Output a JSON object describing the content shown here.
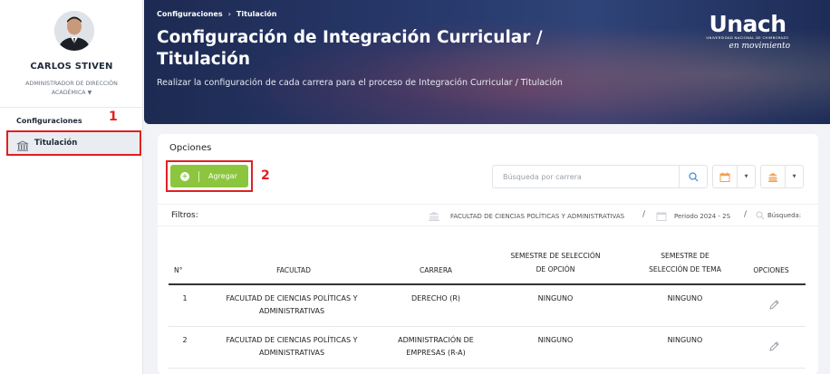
{
  "user": {
    "name": "CARLOS STIVEN",
    "role_line1": "ADMINISTRADOR DE DIRECCIÓN",
    "role_line2": "ACADÉMICA"
  },
  "sidebar": {
    "section": "Configuraciones",
    "items": [
      {
        "label": "Titulación",
        "icon": "institution-icon"
      }
    ]
  },
  "annotations": {
    "first": "1",
    "second": "2"
  },
  "breadcrumb": {
    "root": "Configuraciones",
    "current": "Titulación"
  },
  "header": {
    "title": "Configuración de Integración Curricular / Titulación",
    "subtitle": "Realizar la configuración de cada carrera para el proceso de Integración Curricular / Titulación"
  },
  "logo": {
    "brand": "Unach",
    "tagline": "UNIVERSIDAD NACIONAL DE CHIMBORAZO",
    "slogan": "en movimiento"
  },
  "options": {
    "title": "Opciones",
    "add_label": "Agregar",
    "search_placeholder": "Búsqueda por carrera"
  },
  "filters": {
    "label": "Filtros:",
    "faculty": "FACULTAD DE CIENCIAS POLÍTICAS Y ADMINISTRATIVAS",
    "period": "Periodo 2024 - 2S",
    "search": "Búsqueda:"
  },
  "table": {
    "headers": {
      "num": "N°",
      "faculty": "FACULTAD",
      "career": "CARRERA",
      "sem_option_1": "SEMESTRE DE SELECCIÓN",
      "sem_option_2": "DE OPCIÓN",
      "sem_topic_1": "SEMESTRE DE",
      "sem_topic_2": "SELECCIÓN DE TEMA",
      "options": "OPCIONES"
    },
    "rows": [
      {
        "num": "1",
        "faculty_1": "FACULTAD DE CIENCIAS POLÍTICAS Y",
        "faculty_2": "ADMINISTRATIVAS",
        "career_1": "DERECHO (R)",
        "career_2": "",
        "sem_option": "NINGUNO",
        "sem_topic": "NINGUNO"
      },
      {
        "num": "2",
        "faculty_1": "FACULTAD DE CIENCIAS POLÍTICAS Y",
        "faculty_2": "ADMINISTRATIVAS",
        "career_1": "ADMINISTRACIÓN DE",
        "career_2": "EMPRESAS (R-A)",
        "sem_option": "NINGUNO",
        "sem_topic": "NINGUNO"
      }
    ]
  },
  "colors": {
    "accent_green": "#8cc63f",
    "annotation_red": "#e02020",
    "banner_navy": "#1d2a52"
  }
}
